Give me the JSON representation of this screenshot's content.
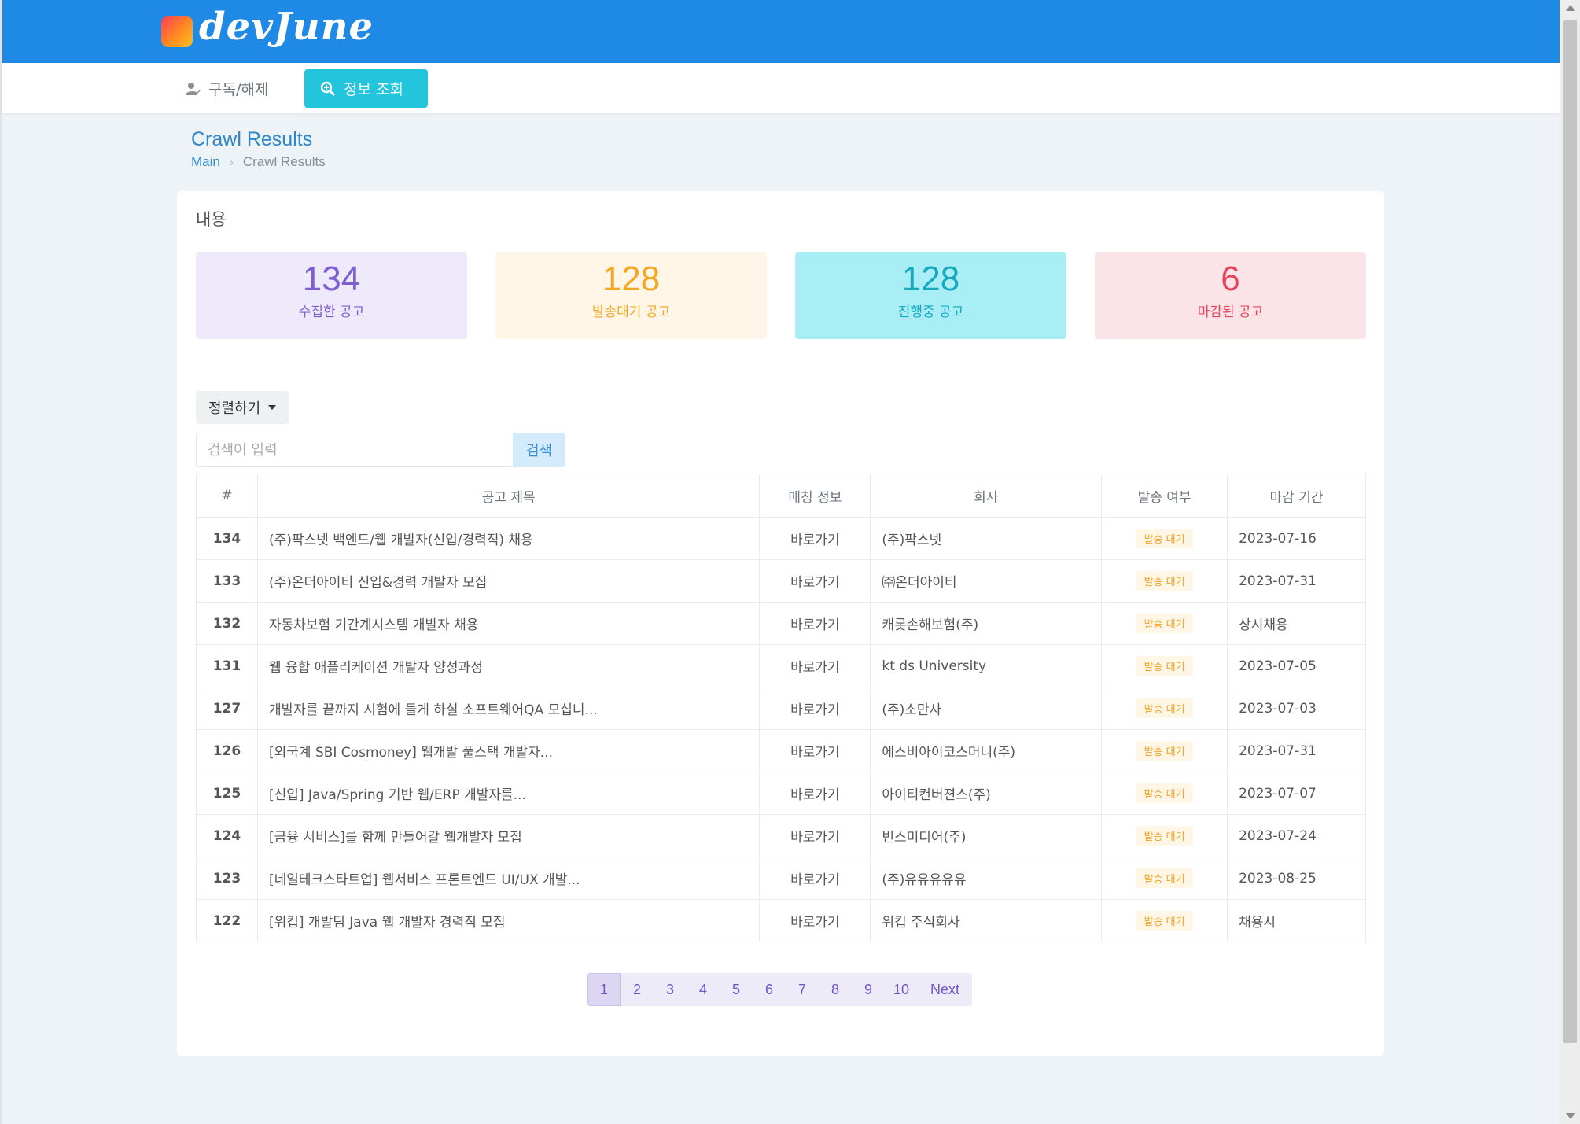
{
  "header": {
    "logo_text": "devJune"
  },
  "menu": {
    "subscribe_label": "구독/해제",
    "view_label": "정보 조회"
  },
  "page": {
    "title": "Crawl Results",
    "breadcrumb": {
      "main": "Main",
      "current": "Crawl Results"
    }
  },
  "card": {
    "title": "내용"
  },
  "stats": [
    {
      "value": "134",
      "label": "수집한 공고"
    },
    {
      "value": "128",
      "label": "발송대기 공고"
    },
    {
      "value": "128",
      "label": "진행중 공고"
    },
    {
      "value": "6",
      "label": "마감된 공고"
    }
  ],
  "sort": {
    "label": "정렬하기"
  },
  "search": {
    "placeholder": "검색어 입력",
    "button": "검색"
  },
  "table": {
    "headers": [
      "#",
      "공고 제목",
      "매칭 정보",
      "회사",
      "발송 여부",
      "마감 기간"
    ],
    "rows": [
      {
        "num": "134",
        "title": "(주)팍스넷 백엔드/웹 개발자(신입/경력직) 채용",
        "link": "바로가기",
        "company": "(주)팍스넷",
        "status": "발송 대기",
        "deadline": "2023-07-16"
      },
      {
        "num": "133",
        "title": "(주)온더아이티 신입&경력 개발자 모집",
        "link": "바로가기",
        "company": "㈜온더아이티",
        "status": "발송 대기",
        "deadline": "2023-07-31"
      },
      {
        "num": "132",
        "title": "자동차보험 기간계시스템 개발자 채용",
        "link": "바로가기",
        "company": "캐롯손해보험(주)",
        "status": "발송 대기",
        "deadline": "상시채용"
      },
      {
        "num": "131",
        "title": "웹 융합 애플리케이션 개발자 양성과정",
        "link": "바로가기",
        "company": "kt ds University",
        "status": "발송 대기",
        "deadline": "2023-07-05"
      },
      {
        "num": "127",
        "title": "개발자를 끝까지 시험에 들게 하실 소프트웨어QA 모십니...",
        "link": "바로가기",
        "company": "(주)소만사",
        "status": "발송 대기",
        "deadline": "2023-07-03"
      },
      {
        "num": "126",
        "title": "[외국계 SBI Cosmoney] 웹개발 풀스택 개발자...",
        "link": "바로가기",
        "company": "에스비아이코스머니(주)",
        "status": "발송 대기",
        "deadline": "2023-07-31"
      },
      {
        "num": "125",
        "title": "[신입] Java/Spring 기반 웹/ERP 개발자를...",
        "link": "바로가기",
        "company": "아이티컨버젼스(주)",
        "status": "발송 대기",
        "deadline": "2023-07-07"
      },
      {
        "num": "124",
        "title": "[금융 서비스]를 함께 만들어갈 웹개발자 모집",
        "link": "바로가기",
        "company": "빈스미디어(주)",
        "status": "발송 대기",
        "deadline": "2023-07-24"
      },
      {
        "num": "123",
        "title": "[네일테크스타트업] 웹서비스 프론트엔드 UI/UX 개발...",
        "link": "바로가기",
        "company": "(주)유유유유유",
        "status": "발송 대기",
        "deadline": "2023-08-25"
      },
      {
        "num": "122",
        "title": "[위킵] 개발팀 Java 웹 개발자 경력직 모집",
        "link": "바로가기",
        "company": "위킵 주식회사",
        "status": "발송 대기",
        "deadline": "채용시"
      }
    ]
  },
  "pagination": {
    "pages": [
      "1",
      "2",
      "3",
      "4",
      "5",
      "6",
      "7",
      "8",
      "9",
      "10"
    ],
    "next": "Next",
    "current": "1"
  }
}
